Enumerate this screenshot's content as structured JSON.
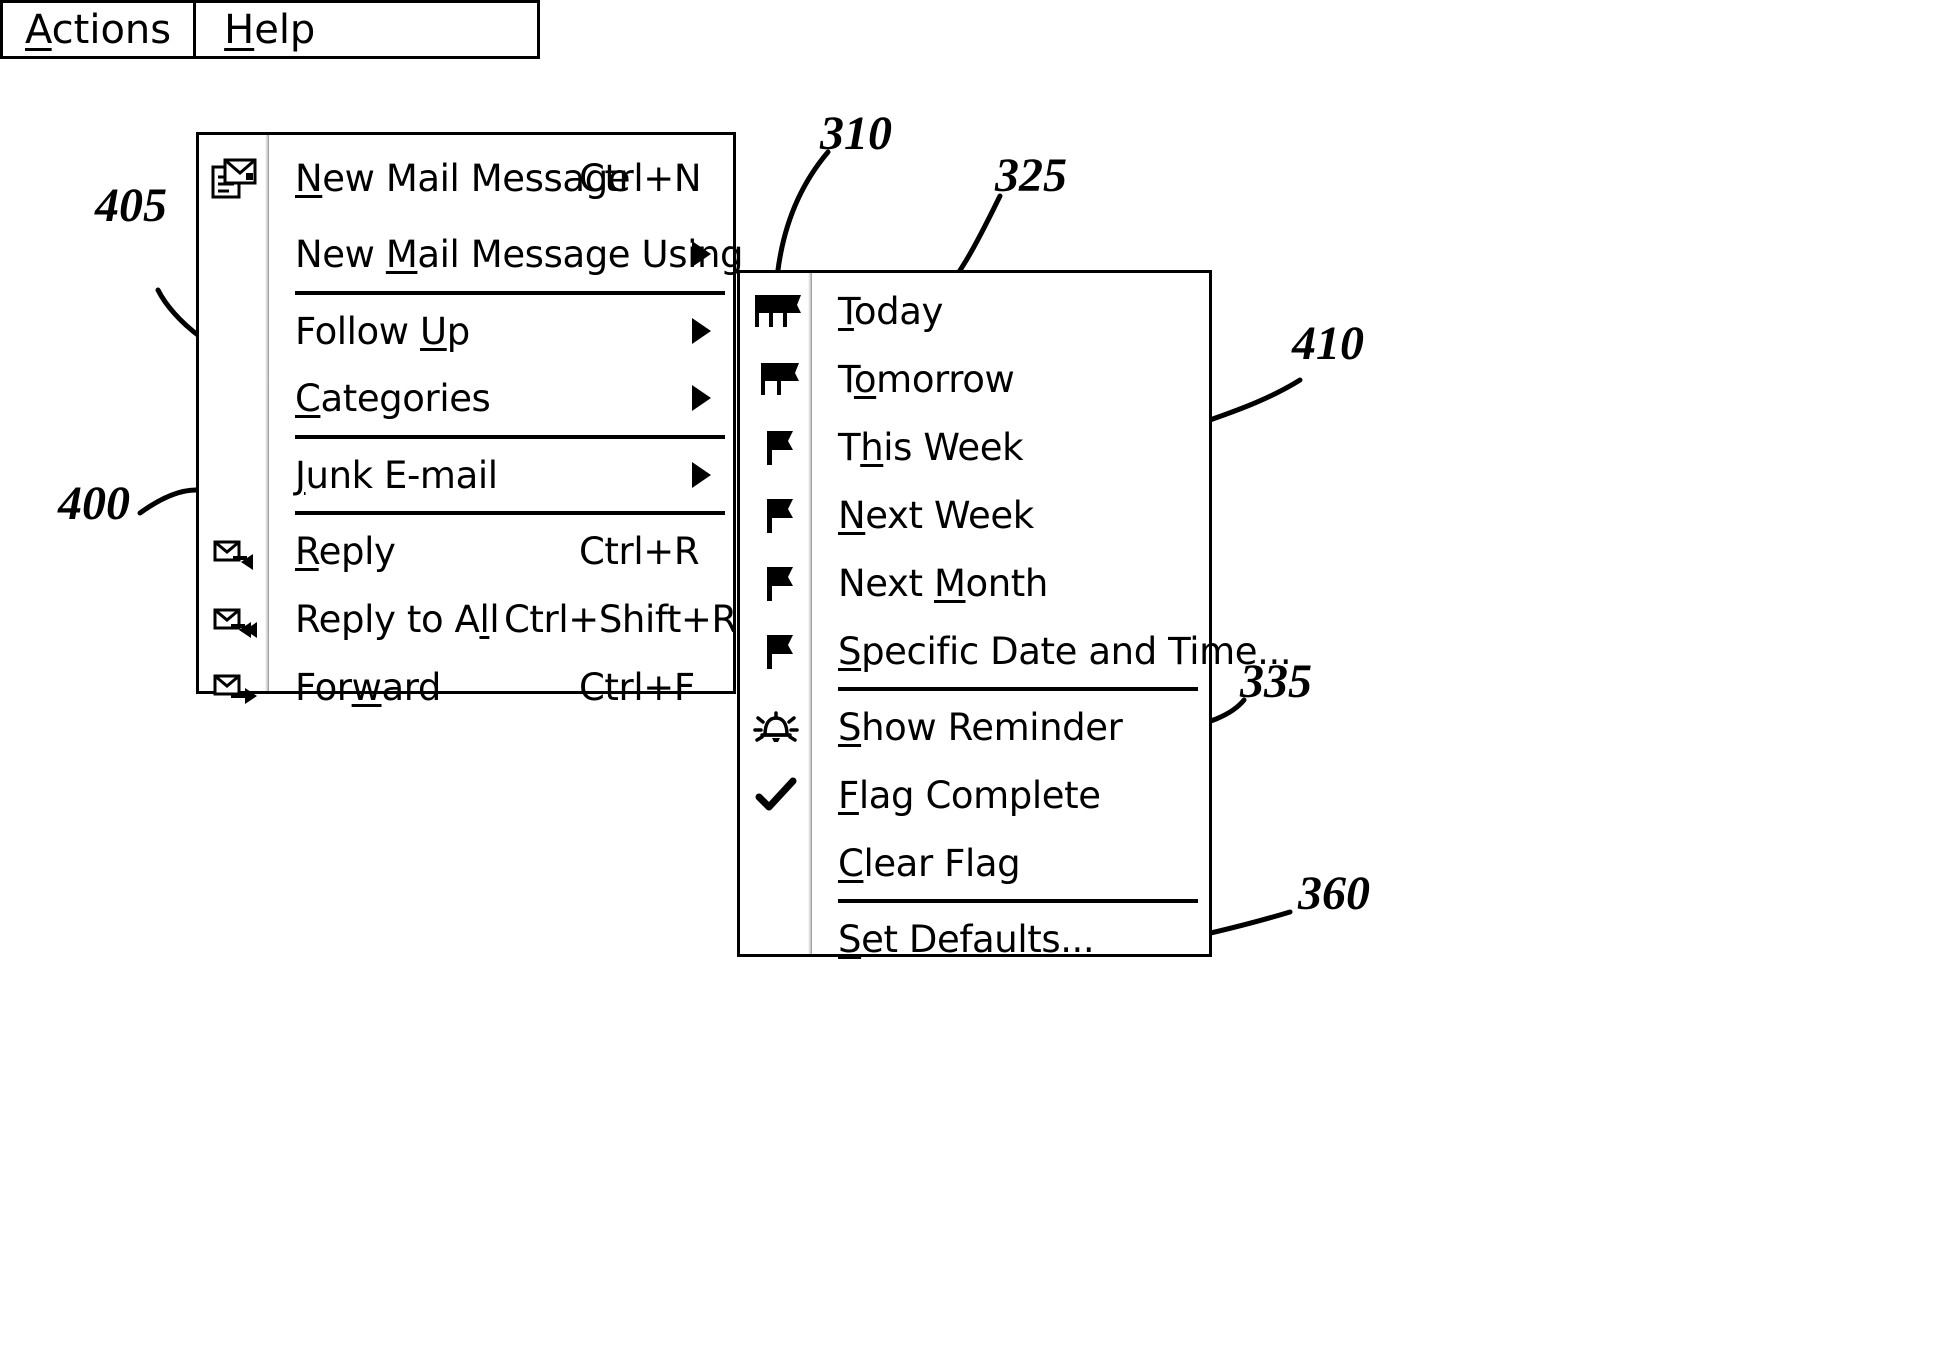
{
  "figure": {
    "menubar": {
      "tabs": [
        {
          "name": "actions",
          "label_pre": "",
          "label_accel": "A",
          "label_post": "ctions",
          "active": true
        },
        {
          "name": "help",
          "label_pre": "",
          "label_accel": "H",
          "label_post": "elp",
          "active": false
        }
      ]
    },
    "actions_menu": {
      "items": [
        {
          "icon": "new-mail-message-icon",
          "pre": "",
          "accel": "N",
          "post": "ew Mail Message",
          "shortcut": "Ctrl+N",
          "submenu": false
        },
        {
          "icon": "",
          "pre": "New ",
          "accel": "M",
          "post": "ail Message Using",
          "shortcut": "",
          "submenu": true
        },
        {
          "separator": true
        },
        {
          "icon": "",
          "pre": "Follow ",
          "accel": "U",
          "post": "p",
          "shortcut": "",
          "submenu": true
        },
        {
          "icon": "",
          "pre": "",
          "accel": "C",
          "post": "ategories",
          "shortcut": "",
          "submenu": true
        },
        {
          "separator": true
        },
        {
          "icon": "",
          "pre": "",
          "accel": "J",
          "post": "unk E-mail",
          "shortcut": "",
          "submenu": true
        },
        {
          "separator": true
        },
        {
          "icon": "reply-icon",
          "pre": "",
          "accel": "R",
          "post": "eply",
          "shortcut": "Ctrl+R",
          "submenu": false
        },
        {
          "icon": "reply-all-icon",
          "pre": "Reply to A",
          "accel": "l",
          "post": "l",
          "shortcut": "Ctrl+Shift+R",
          "submenu": false
        },
        {
          "icon": "forward-icon",
          "pre": "For",
          "accel": "w",
          "post": "ard",
          "shortcut": "Ctrl+F",
          "submenu": false
        }
      ]
    },
    "followup_menu": {
      "items": [
        {
          "icon": "flag-triple-icon",
          "pre": "",
          "accel": "T",
          "post": "oday"
        },
        {
          "icon": "flag-double-icon",
          "pre": "T",
          "accel": "o",
          "post": "morrow"
        },
        {
          "icon": "flag-single-icon",
          "pre": "T",
          "accel": "h",
          "post": "is Week"
        },
        {
          "icon": "flag-single-icon",
          "pre": "",
          "accel": "N",
          "post": "ext Week"
        },
        {
          "icon": "flag-single-icon",
          "pre": "Next ",
          "accel": "M",
          "post": "onth"
        },
        {
          "icon": "flag-single-icon",
          "pre": "",
          "accel": "S",
          "post": "pecific Date and Time..."
        },
        {
          "separator": true
        },
        {
          "icon": "bell-reminder-icon",
          "pre": "",
          "accel": "S",
          "post": "how Reminder"
        },
        {
          "icon": "checkmark-icon",
          "pre": "",
          "accel": "F",
          "post": "lag Complete"
        },
        {
          "icon": "",
          "pre": "",
          "accel": "C",
          "post": "lear Flag"
        },
        {
          "separator": true
        },
        {
          "icon": "",
          "pre": "",
          "accel": "S",
          "post": "et Defaults..."
        }
      ]
    },
    "reference_numerals": [
      {
        "id": "ref-400",
        "label": "400"
      },
      {
        "id": "ref-405",
        "label": "405"
      },
      {
        "id": "ref-410",
        "label": "410"
      },
      {
        "id": "ref-310",
        "label": "310"
      },
      {
        "id": "ref-325",
        "label": "325"
      },
      {
        "id": "ref-335",
        "label": "335"
      },
      {
        "id": "ref-360",
        "label": "360"
      }
    ]
  }
}
